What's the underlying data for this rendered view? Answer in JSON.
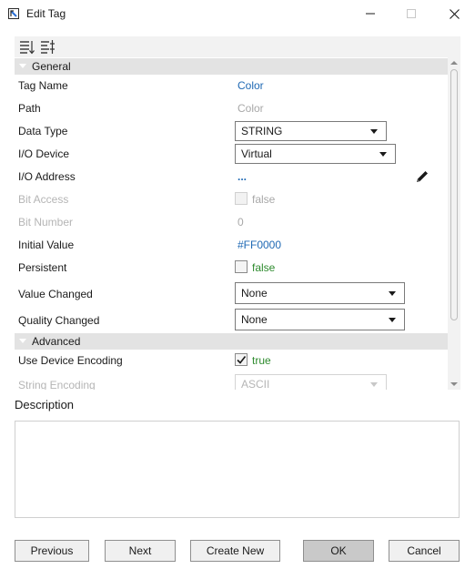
{
  "window": {
    "title": "Edit Tag",
    "icons": {
      "app": "app-logo-icon",
      "minimize": "minimize-icon",
      "maximize": "maximize-icon",
      "close": "close-icon"
    }
  },
  "toolbar": {
    "icons": [
      "sort-categorized-icon",
      "sort-alphabetical-icon"
    ]
  },
  "categories": {
    "general": "General",
    "advanced": "Advanced"
  },
  "properties": {
    "tag_name": {
      "label": "Tag Name",
      "value": "Color"
    },
    "path": {
      "label": "Path",
      "value": "Color"
    },
    "data_type": {
      "label": "Data Type",
      "value": "STRING"
    },
    "io_device": {
      "label": "I/O Device",
      "value": "Virtual"
    },
    "io_address": {
      "label": "I/O Address",
      "value": "...",
      "icon": "edit-pencil-icon"
    },
    "bit_access": {
      "label": "Bit Access",
      "value": "false",
      "checked": false
    },
    "bit_number": {
      "label": "Bit Number",
      "value": "0"
    },
    "initial_value": {
      "label": "Initial Value",
      "value": "#FF0000"
    },
    "persistent": {
      "label": "Persistent",
      "value": "false",
      "checked": false
    },
    "value_changed": {
      "label": "Value Changed",
      "value": "None"
    },
    "quality_changed": {
      "label": "Quality Changed",
      "value": "None"
    },
    "use_device_encoding": {
      "label": "Use Device Encoding",
      "value": "true",
      "checked": true
    },
    "string_encoding": {
      "label": "String Encoding",
      "value": "ASCII"
    }
  },
  "description": {
    "label": "Description",
    "value": ""
  },
  "buttons": {
    "previous": "Previous",
    "next": "Next",
    "create_new": "Create New",
    "ok": "OK",
    "cancel": "Cancel"
  },
  "colors": {
    "link": "#1f69b4",
    "bool": "#2e8b2e",
    "category": "#e3e3e3",
    "disabled": "#b5b5b5"
  }
}
